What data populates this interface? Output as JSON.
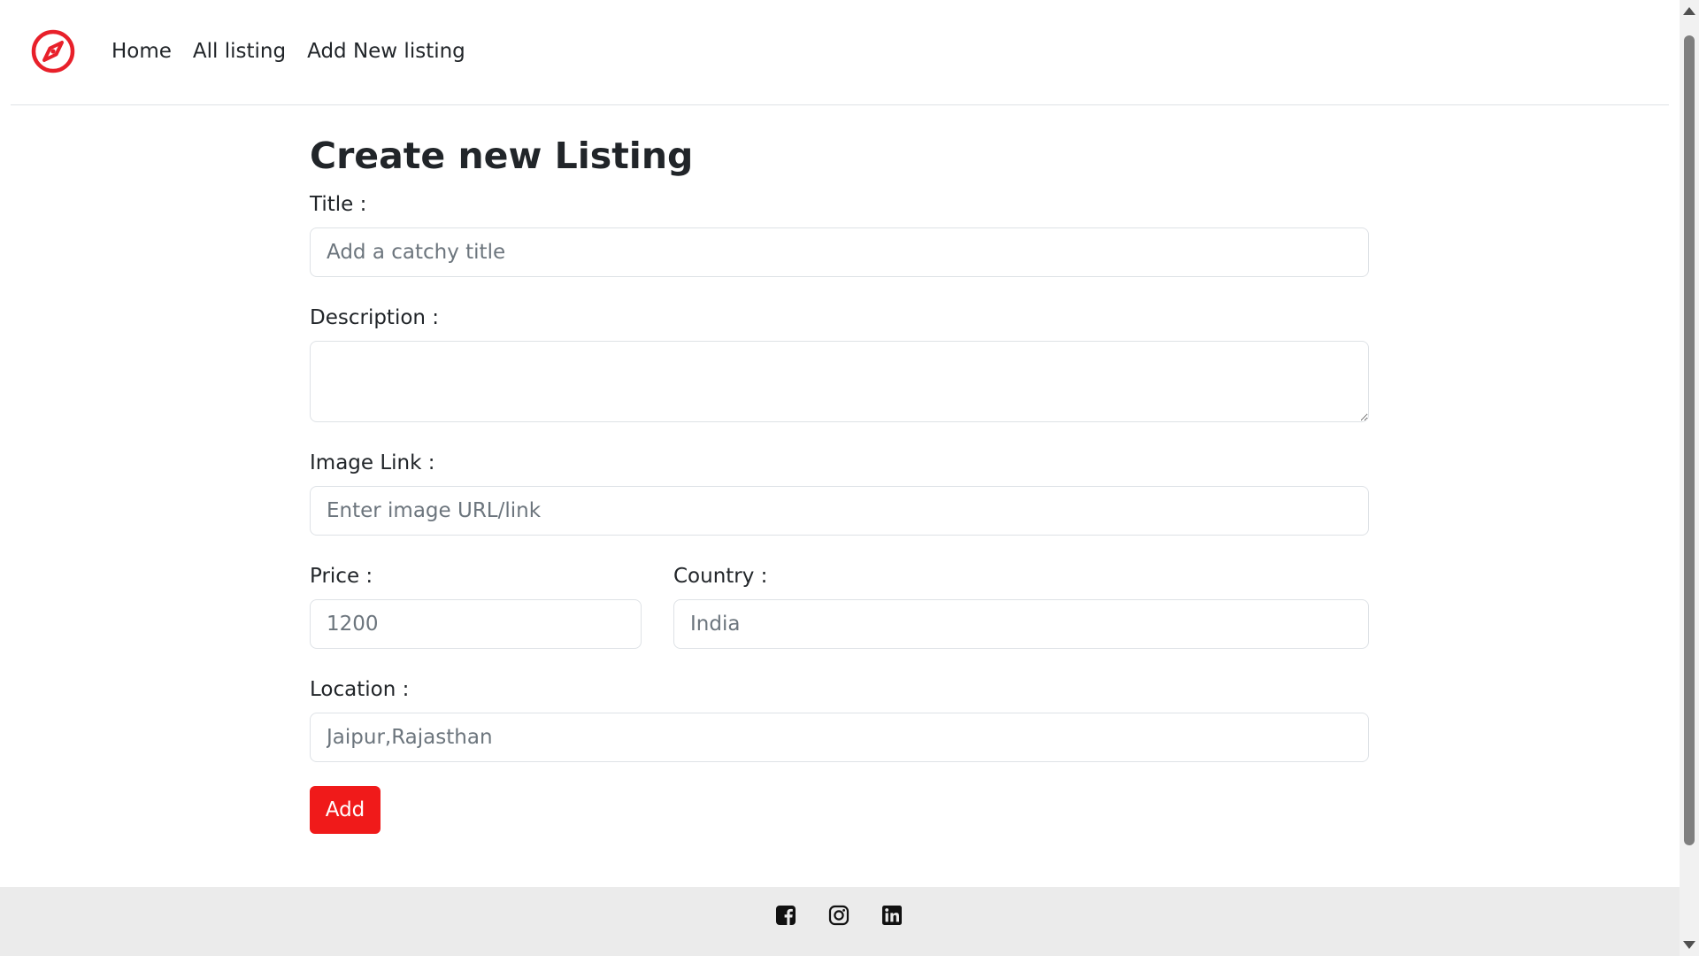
{
  "nav": {
    "brand_icon": "compass-icon",
    "brand_color": "#e8202a",
    "links": [
      "Home",
      "All listing",
      "Add New listing"
    ]
  },
  "form": {
    "heading": "Create new Listing",
    "title_label": "Title :",
    "title_placeholder": "Add a catchy title",
    "description_label": "Description :",
    "description_value": "",
    "image_label": "Image Link :",
    "image_placeholder": "Enter image URL/link",
    "price_label": "Price :",
    "price_placeholder": "1200",
    "country_label": "Country :",
    "country_placeholder": "India",
    "location_label": "Location :",
    "location_placeholder": "Jaipur,Rajasthan",
    "submit_label": "Add",
    "submit_color": "#f01a1a"
  },
  "footer": {
    "social_icons": [
      "facebook-icon",
      "instagram-icon",
      "linkedin-icon"
    ],
    "background": "#ebebeb"
  }
}
